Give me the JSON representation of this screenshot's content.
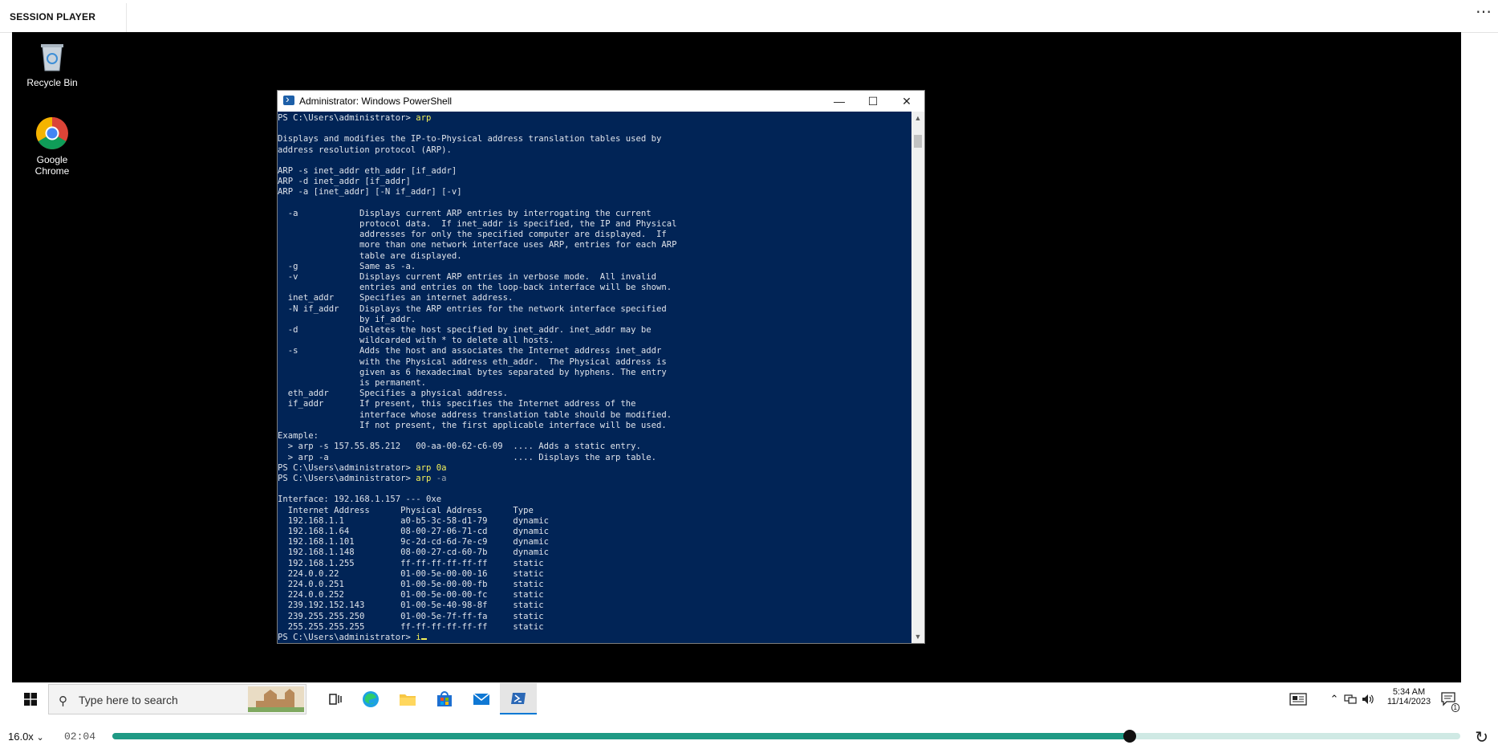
{
  "player": {
    "title": "SESSION PLAYER",
    "menu_label": "⋯",
    "speed": "16.0x",
    "speed_chevron": "⌄",
    "elapsed": "02:04",
    "progress_fraction": 0.755,
    "replay_glyph": "↻"
  },
  "desktop": {
    "icons": [
      {
        "label": "Recycle Bin",
        "icon": "recycle-bin-icon"
      },
      {
        "label": "Google Chrome",
        "icon": "chrome-icon"
      }
    ]
  },
  "window": {
    "title": "Administrator: Windows PowerShell",
    "minimize": "—",
    "maximize": "☐",
    "close": "✕",
    "console": {
      "prompt": "PS C:\\Users\\administrator> ",
      "cmd1": "arp",
      "help_text": "\nDisplays and modifies the IP-to-Physical address translation tables used by\naddress resolution protocol (ARP).\n\nARP -s inet_addr eth_addr [if_addr]\nARP -d inet_addr [if_addr]\nARP -a [inet_addr] [-N if_addr] [-v]\n\n  -a            Displays current ARP entries by interrogating the current\n                protocol data.  If inet_addr is specified, the IP and Physical\n                addresses for only the specified computer are displayed.  If\n                more than one network interface uses ARP, entries for each ARP\n                table are displayed.\n  -g            Same as -a.\n  -v            Displays current ARP entries in verbose mode.  All invalid\n                entries and entries on the loop-back interface will be shown.\n  inet_addr     Specifies an internet address.\n  -N if_addr    Displays the ARP entries for the network interface specified\n                by if_addr.\n  -d            Deletes the host specified by inet_addr. inet_addr may be\n                wildcarded with * to delete all hosts.\n  -s            Adds the host and associates the Internet address inet_addr\n                with the Physical address eth_addr.  The Physical address is\n                given as 6 hexadecimal bytes separated by hyphens. The entry\n                is permanent.\n  eth_addr      Specifies a physical address.\n  if_addr       If present, this specifies the Internet address of the\n                interface whose address translation table should be modified.\n                If not present, the first applicable interface will be used.\nExample:\n  > arp -s 157.55.85.212   00-aa-00-62-c6-09  .... Adds a static entry.\n  > arp -a                                    .... Displays the arp table.",
      "cmd2": "arp 0a",
      "cmd3_name": "arp",
      "cmd3_arg": " -a",
      "table_text": "\nInterface: 192.168.1.157 --- 0xe\n  Internet Address      Physical Address      Type\n  192.168.1.1           a0-b5-3c-58-d1-79     dynamic\n  192.168.1.64          08-00-27-06-71-cd     dynamic\n  192.168.1.101         9c-2d-cd-6d-7e-c9     dynamic\n  192.168.1.148         08-00-27-cd-60-7b     dynamic\n  192.168.1.255         ff-ff-ff-ff-ff-ff     static\n  224.0.0.22            01-00-5e-00-00-16     static\n  224.0.0.251           01-00-5e-00-00-fb     static\n  224.0.0.252           01-00-5e-00-00-fc     static\n  239.192.152.143       01-00-5e-40-98-8f     static\n  239.255.255.250       01-00-5e-7f-ff-fa     static\n  255.255.255.255       ff-ff-ff-ff-ff-ff     static",
      "current_input": "i"
    }
  },
  "taskbar": {
    "search_placeholder": "Type here to search",
    "clock_time": "5:34 AM",
    "clock_date": "11/14/2023",
    "notification_count": "1",
    "colors": {
      "accent": "#0078d4",
      "console_bg": "#012456",
      "progress": "#1f9a85"
    }
  }
}
